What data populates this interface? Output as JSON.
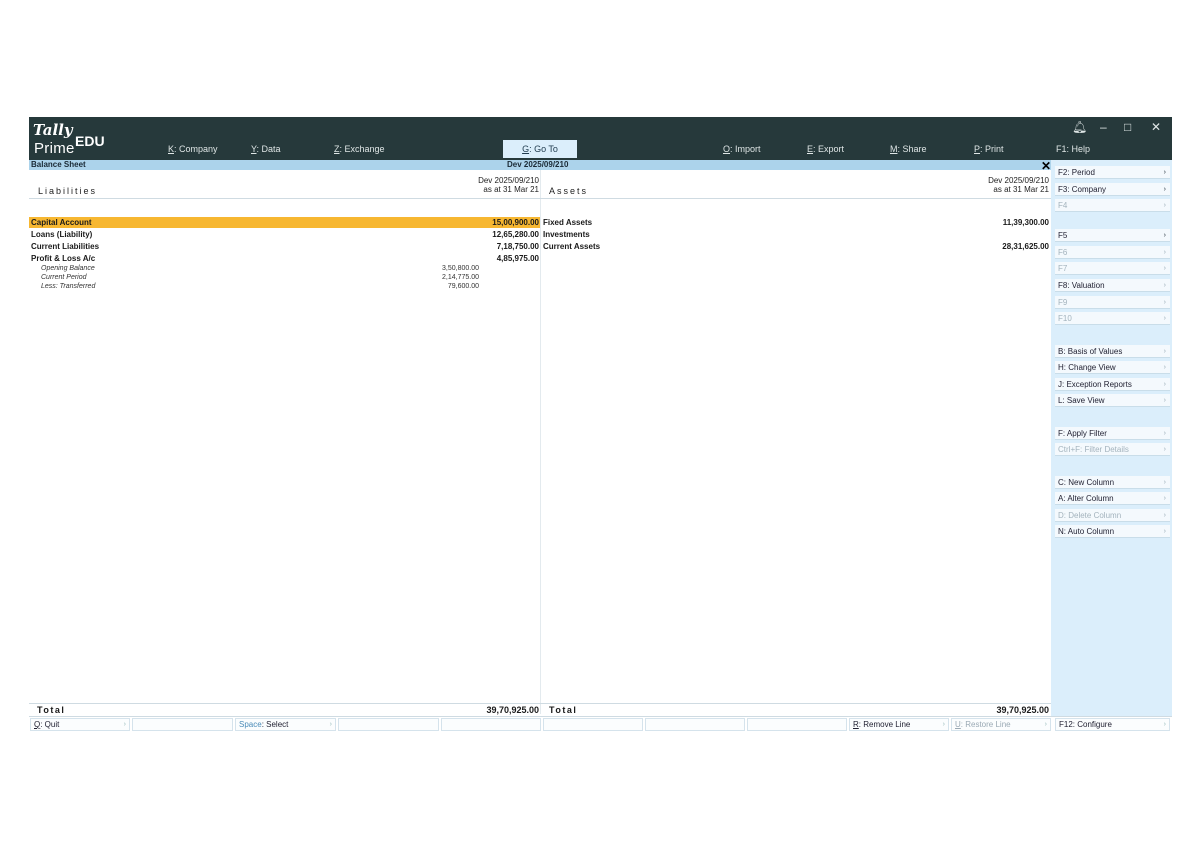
{
  "logo": {
    "brand": "Tally",
    "edition": "EDU",
    "product": "Prime"
  },
  "topbar": {
    "menu": [
      {
        "key": "K",
        "rest": ": Company"
      },
      {
        "key": "Y",
        "rest": ": Data"
      },
      {
        "key": "Z",
        "rest": ": Exchange"
      }
    ],
    "goto": {
      "key": "G",
      "rest": ": Go To"
    },
    "menu_right": [
      {
        "key": "O",
        "rest": ": Import"
      },
      {
        "key": "E",
        "rest": ": Export"
      },
      {
        "key": "M",
        "rest": ": Share"
      },
      {
        "key": "P",
        "rest": ": Print"
      }
    ],
    "help": "F1: Help",
    "window_controls": [
      "bell-icon",
      "minimize-icon",
      "restore-icon",
      "close-icon"
    ]
  },
  "title": {
    "report": "Balance Sheet",
    "company": "Dev 2025/09/210",
    "close": "✕"
  },
  "liabilities": {
    "title": "Liabilities",
    "company": "Dev 2025/09/210",
    "period": "as at 31 Mar 21",
    "rows": [
      {
        "label": "Capital Account",
        "amount": "15,00,900.00",
        "selected": true
      },
      {
        "label": "Loans (Liability)",
        "amount": "12,65,280.00"
      },
      {
        "label": "Current Liabilities",
        "amount": "7,18,750.00"
      },
      {
        "label": "Profit & Loss A/c",
        "amount": "4,85,975.00"
      }
    ],
    "sub_rows": [
      {
        "label": "Opening Balance",
        "amount": "3,50,800.00"
      },
      {
        "label": "Current Period",
        "amount": "2,14,775.00"
      },
      {
        "label": "Less: Transferred",
        "amount": "79,600.00"
      }
    ],
    "total_label": "Total",
    "total": "39,70,925.00"
  },
  "assets": {
    "title": "Assets",
    "company": "Dev 2025/09/210",
    "period": "as at 31 Mar 21",
    "rows": [
      {
        "label": "Fixed Assets",
        "amount": "11,39,300.00"
      },
      {
        "label": "Investments",
        "amount": ""
      },
      {
        "label": "Current Assets",
        "amount": "28,31,625.00"
      }
    ],
    "total_label": "Total",
    "total": "39,70,925.00"
  },
  "bottombar": {
    "quit": {
      "key": "Q",
      "rest": ": Quit"
    },
    "select": {
      "key": "Space",
      "rest": ": Select"
    },
    "remove_line": {
      "key": "R",
      "rest": ": Remove Line"
    },
    "restore_line": {
      "key": "U",
      "rest": ": Restore Line"
    },
    "configure": "F12: Configure"
  },
  "sidebar": {
    "buttons": [
      {
        "label": "F2: Period",
        "state": "strong"
      },
      {
        "label": "F3: Company",
        "state": "strong"
      },
      {
        "label": "F4",
        "state": "dim"
      },
      {
        "label": "F5",
        "state": "strong"
      },
      {
        "label": "F6",
        "state": "dim"
      },
      {
        "label": "F7",
        "state": "dim"
      },
      {
        "label": "F8: Valuation",
        "state": "normal"
      },
      {
        "label": "F9",
        "state": "dim"
      },
      {
        "label": "F10",
        "state": "dim"
      },
      {
        "label": "B: Basis of Values",
        "state": "normal"
      },
      {
        "label": "H: Change View",
        "state": "normal"
      },
      {
        "label": "J: Exception Reports",
        "state": "normal"
      },
      {
        "label": "L: Save View",
        "state": "normal"
      },
      {
        "label": "F: Apply Filter",
        "state": "normal"
      },
      {
        "label": "Ctrl+F: Filter Details",
        "state": "dim"
      },
      {
        "label": "C: New Column",
        "state": "normal"
      },
      {
        "label": "A: Alter Column",
        "state": "normal"
      },
      {
        "label": "D: Delete Column",
        "state": "dim"
      },
      {
        "label": "N: Auto Column",
        "state": "normal"
      }
    ]
  },
  "colors": {
    "topbar": "#26393b",
    "accent": "#f7b731",
    "sidebar": "#dbeefb",
    "strip": "#acd3eb"
  }
}
